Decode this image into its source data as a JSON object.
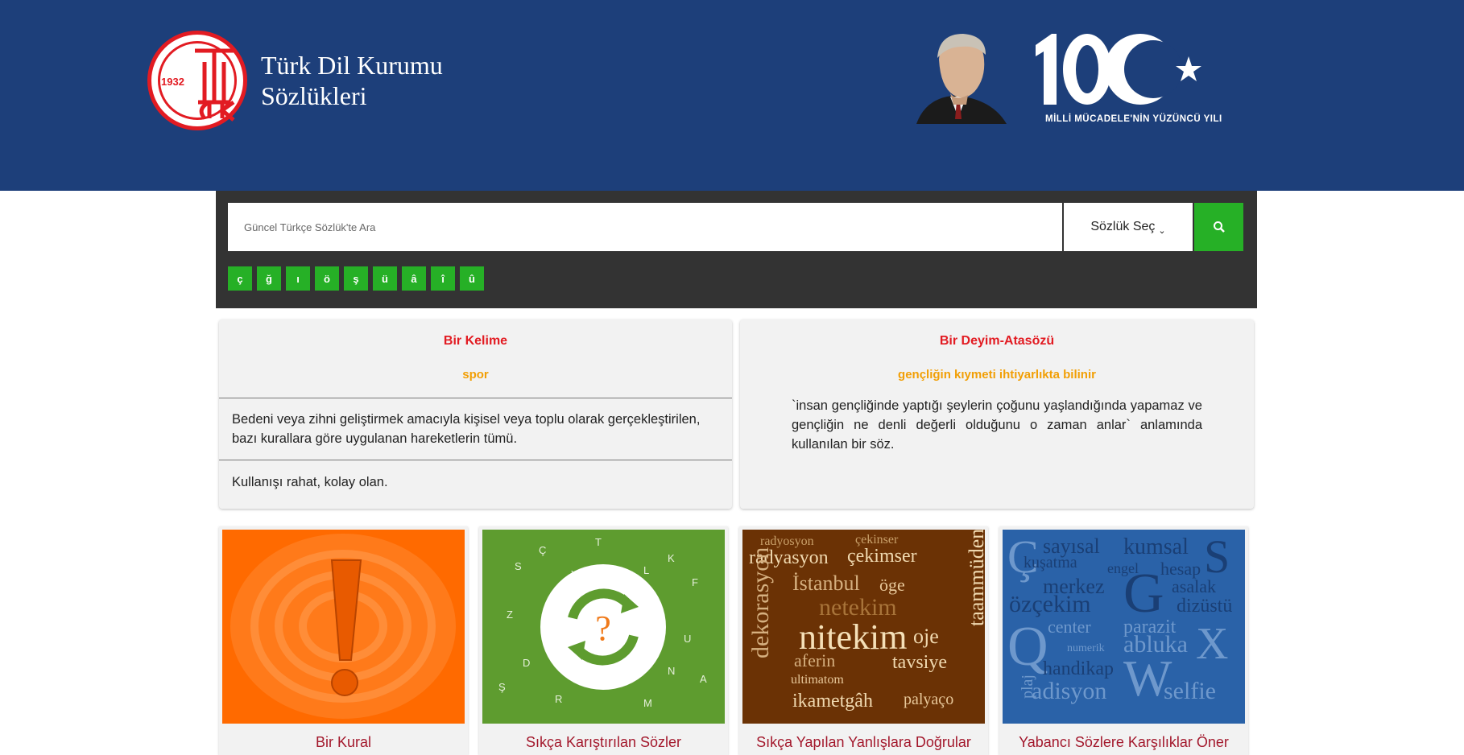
{
  "header": {
    "logo_year": "1932",
    "title_line1": "Türk Dil Kurumu",
    "title_line2": "Sözlükleri",
    "centennial_caption": "MİLLİ MÜCADELE'NİN YÜZÜNCÜ YILI"
  },
  "search": {
    "placeholder": "Güncel Türkçe Sözlük'te Ara",
    "dictionary_select": "Sözlük Seç",
    "special_chars": [
      "ç",
      "ğ",
      "ı",
      "ö",
      "ş",
      "ü",
      "â",
      "î",
      "û"
    ]
  },
  "word_card": {
    "heading": "Bir Kelime",
    "word": "spor",
    "meanings": [
      "Bedeni veya zihni geliştirmek amacıyla kişisel veya toplu olarak gerçekleştirilen, bazı kurallara göre uygulanan hareketlerin tümü.",
      "Kullanışı rahat, kolay olan."
    ]
  },
  "idiom_card": {
    "heading": "Bir Deyim-Atasözü",
    "phrase": "gençliğin kıymeti ihtiyarlıkta bilinir",
    "meaning": "`insan gençliğinde yaptığı şeylerin çoğunu yaşlandığında yapamaz ve gençliğin ne denli değerli olduğunu o zaman anlar` anlamında kullanılan bir söz."
  },
  "tiles": [
    {
      "label": "Bir Kural"
    },
    {
      "label": "Sıkça Karıştırılan Sözler"
    },
    {
      "label": "Sıkça Yapılan Yanlışlara Doğrular"
    },
    {
      "label": "Yabancı Sözlere Karşılıklar Öner"
    }
  ],
  "colors": {
    "header_bg": "#1d3f7a",
    "accent_green": "#26b026",
    "heading_red": "#e21b22",
    "word_orange": "#f29f05",
    "tile_label": "#a3182c"
  },
  "icons": [
    "tdk-logo",
    "ataturk-portrait",
    "centennial-100-logo",
    "search-icon",
    "caret-down-icon",
    "exclamation-icon",
    "question-cycle-icon"
  ]
}
